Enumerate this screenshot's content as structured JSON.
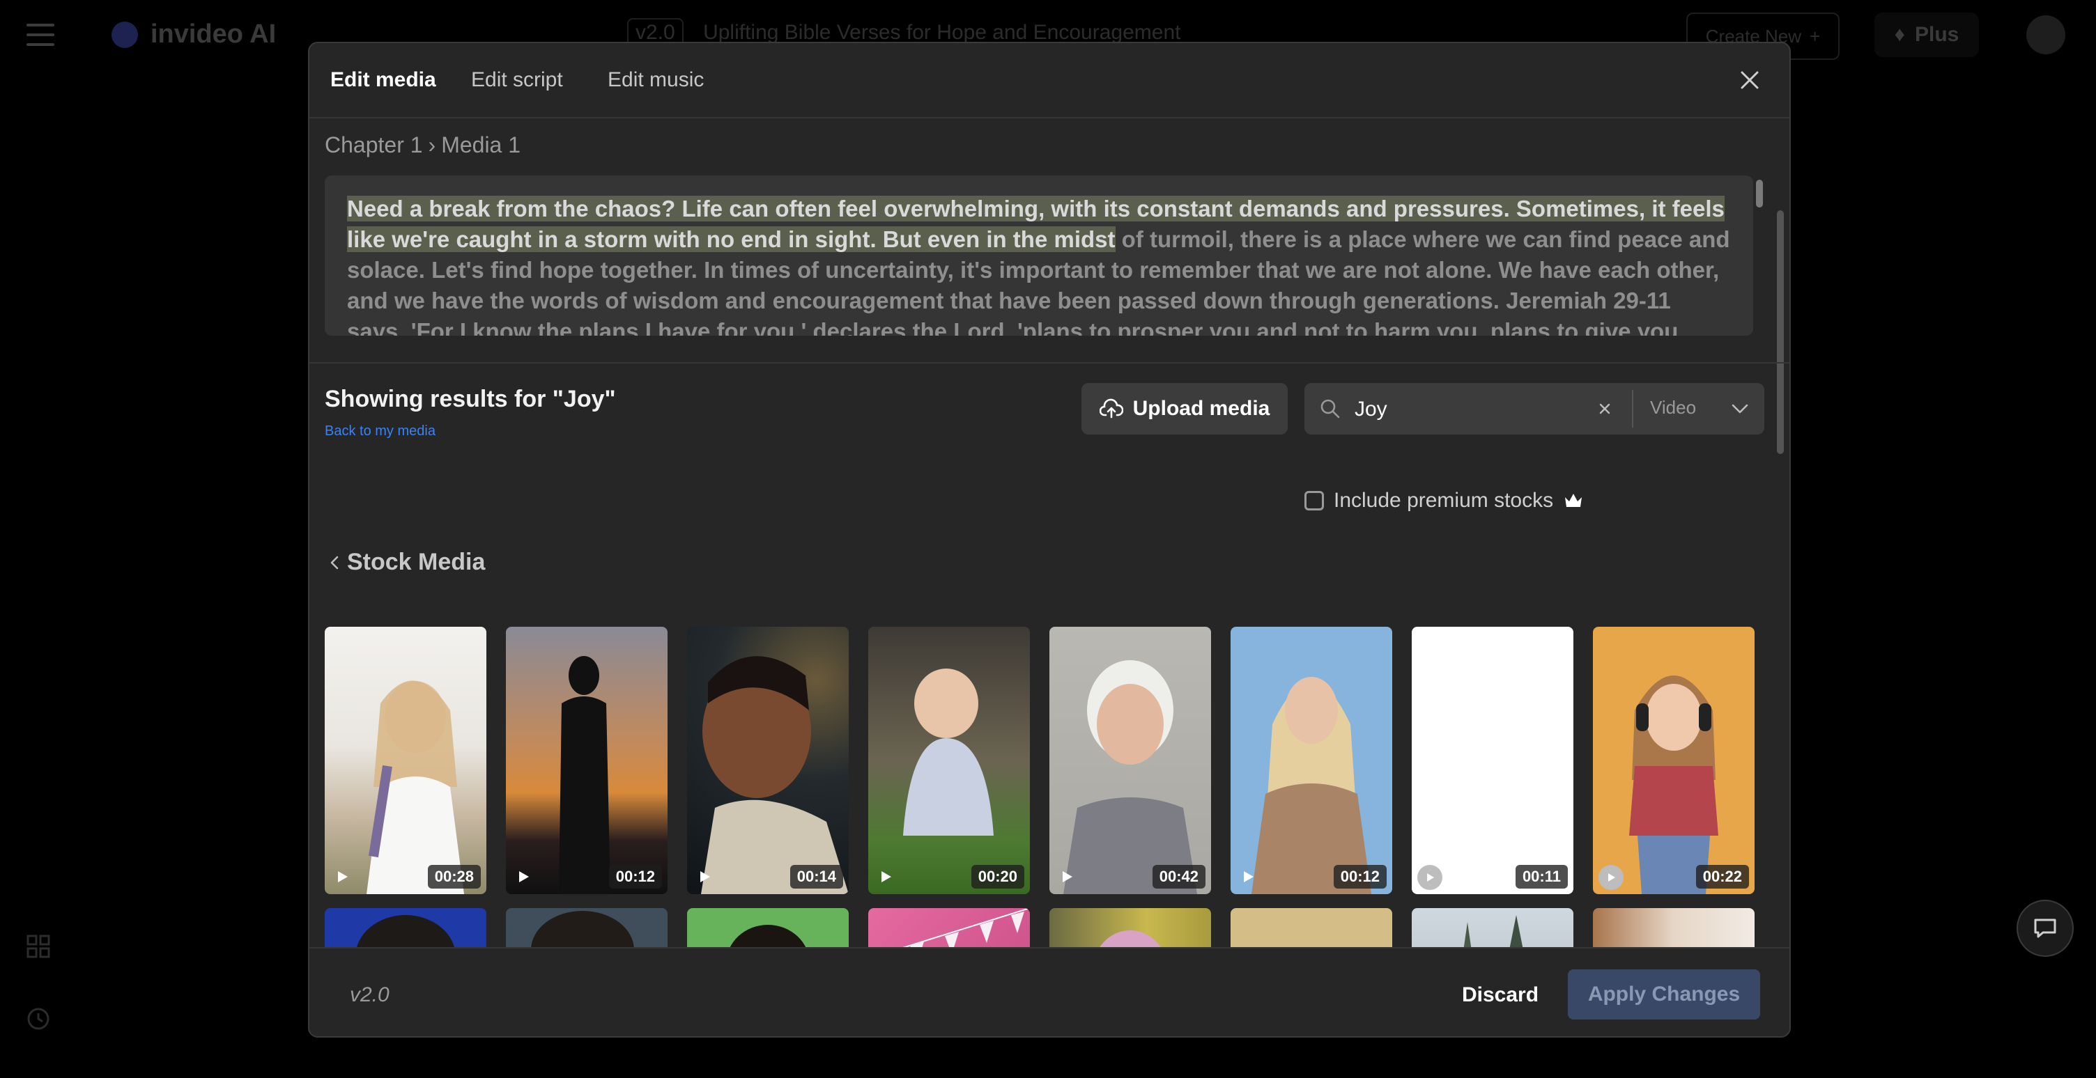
{
  "app": {
    "logo_text": "invideo AI",
    "project_version": "v2.0",
    "project_title": "Uplifting Bible Verses for Hope and Encouragement",
    "create_new_label": "Create New",
    "plus_label": "Plus"
  },
  "modal": {
    "tabs": [
      {
        "label": "Edit media",
        "active": true
      },
      {
        "label": "Edit script",
        "active": false
      },
      {
        "label": "Edit music",
        "active": false
      }
    ],
    "breadcrumb": {
      "chapter": "Chapter 1",
      "separator": "›",
      "media": "Media 1"
    },
    "script": {
      "highlighted": "Need a break from the chaos? Life can often feel overwhelming, with its constant demands and pressures. Sometimes, it feels like we're caught in a storm with no end in sight. But even in the midst",
      "rest": " of turmoil, there is a place where we can find peace and solace. Let's find hope together. In times of uncertainty, it's important to remember that we are not alone. We have each other, and we have the words of wisdom and encouragement that have been passed down through generations. Jeremiah 29-11 says, 'For I know the plans I have for you,' declares the Lord, 'plans to prosper you and not to harm you, plans to give you hope and a future.'"
    },
    "results": {
      "title": "Showing results for \"Joy\"",
      "back_link": "Back to my media"
    },
    "upload_label": "Upload media",
    "search": {
      "value": "Joy",
      "type": "Video"
    },
    "premium_label": "Include premium stocks",
    "stock_heading": "Stock Media",
    "thumbnails": [
      {
        "duration": "00:28"
      },
      {
        "duration": "00:12"
      },
      {
        "duration": "00:14"
      },
      {
        "duration": "00:20"
      },
      {
        "duration": "00:42"
      },
      {
        "duration": "00:12"
      },
      {
        "duration": "00:11"
      },
      {
        "duration": "00:22"
      }
    ],
    "footer": {
      "version": "v2.0",
      "discard_label": "Discard",
      "apply_label": "Apply Changes"
    }
  }
}
